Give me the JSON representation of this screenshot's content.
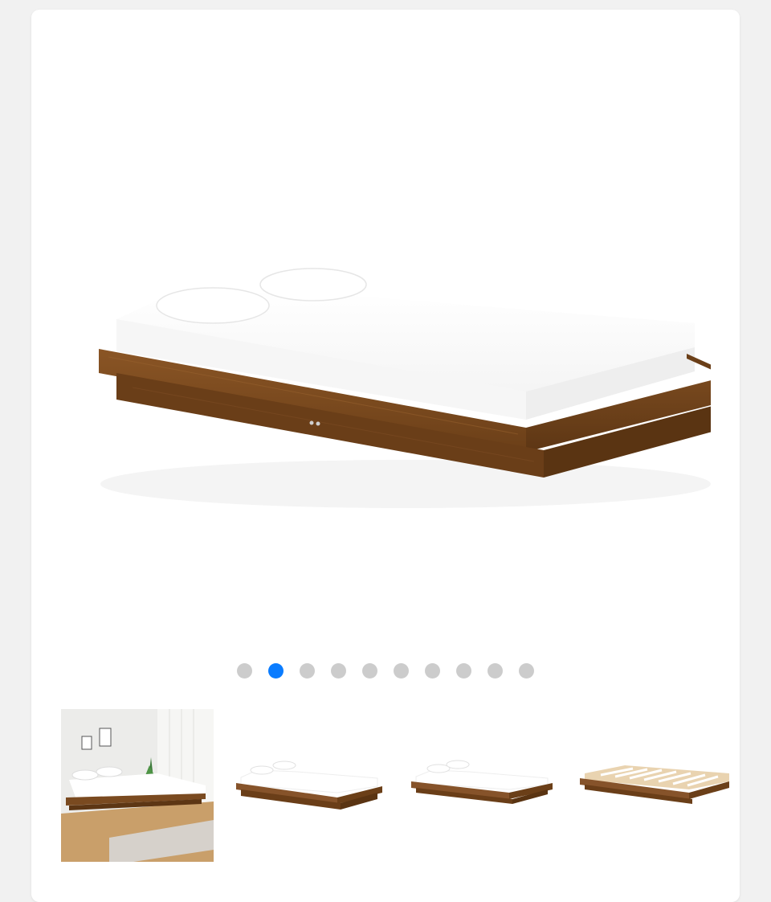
{
  "gallery": {
    "main_image": {
      "icon": "bed-frame-photo",
      "frame_color": "#7a4a20",
      "mattress_color": "#ffffff"
    },
    "active_slide": 2,
    "slide_count": 10,
    "colors": {
      "dot_active": "#0a7cff",
      "dot_inactive": "#cccccc"
    },
    "thumbnails": [
      {
        "icon": "bedroom-scene-photo"
      },
      {
        "icon": "bed-frame-photo"
      },
      {
        "icon": "bed-frame-photo"
      },
      {
        "icon": "bed-slats-photo"
      }
    ]
  }
}
